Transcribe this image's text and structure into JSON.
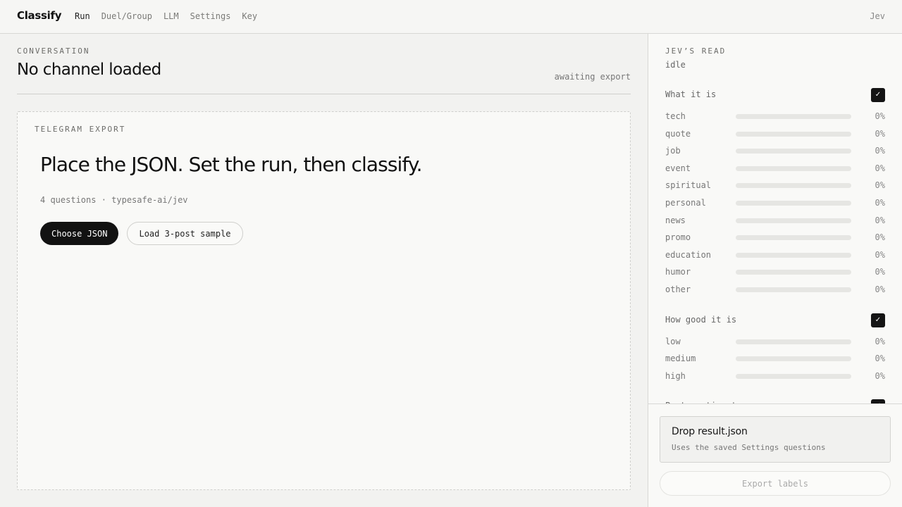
{
  "header": {
    "brand": "Classify",
    "nav": [
      {
        "label": "Run",
        "active": true
      },
      {
        "label": "Duel/Group",
        "active": false
      },
      {
        "label": "LLM",
        "active": false
      },
      {
        "label": "Settings",
        "active": false
      },
      {
        "label": "Key",
        "active": false
      }
    ],
    "user": "Jev"
  },
  "conversation": {
    "section_label": "CONVERSATION",
    "title": "No channel loaded",
    "status": "awaiting export"
  },
  "dropzone": {
    "label": "TELEGRAM EXPORT",
    "title": "Place the JSON. Set the run, then classify.",
    "meta": "4 questions · typesafe-ai/jev",
    "primary_button": "Choose JSON",
    "secondary_button": "Load 3-post sample"
  },
  "sidebar": {
    "title": "JEV’S READ",
    "state": "idle",
    "check_glyph": "✓",
    "groups": [
      {
        "name": "What it is",
        "checked": true,
        "rows": [
          {
            "label": "tech",
            "value": 0,
            "pct": "0%"
          },
          {
            "label": "quote",
            "value": 0,
            "pct": "0%"
          },
          {
            "label": "job",
            "value": 0,
            "pct": "0%"
          },
          {
            "label": "event",
            "value": 0,
            "pct": "0%"
          },
          {
            "label": "spiritual",
            "value": 0,
            "pct": "0%"
          },
          {
            "label": "personal",
            "value": 0,
            "pct": "0%"
          },
          {
            "label": "news",
            "value": 0,
            "pct": "0%"
          },
          {
            "label": "promo",
            "value": 0,
            "pct": "0%"
          },
          {
            "label": "education",
            "value": 0,
            "pct": "0%"
          },
          {
            "label": "humor",
            "value": 0,
            "pct": "0%"
          },
          {
            "label": "other",
            "value": 0,
            "pct": "0%"
          }
        ]
      },
      {
        "name": "How good it is",
        "checked": true,
        "rows": [
          {
            "label": "low",
            "value": 0,
            "pct": "0%"
          },
          {
            "label": "medium",
            "value": 0,
            "pct": "0%"
          },
          {
            "label": "high",
            "value": 0,
            "pct": "0%"
          }
        ]
      },
      {
        "name": "Post sentiment",
        "checked": true,
        "rows": []
      }
    ],
    "drop_title": "Drop result.json",
    "drop_subtitle": "Uses the saved Settings questions",
    "export_button": "Export labels"
  }
}
